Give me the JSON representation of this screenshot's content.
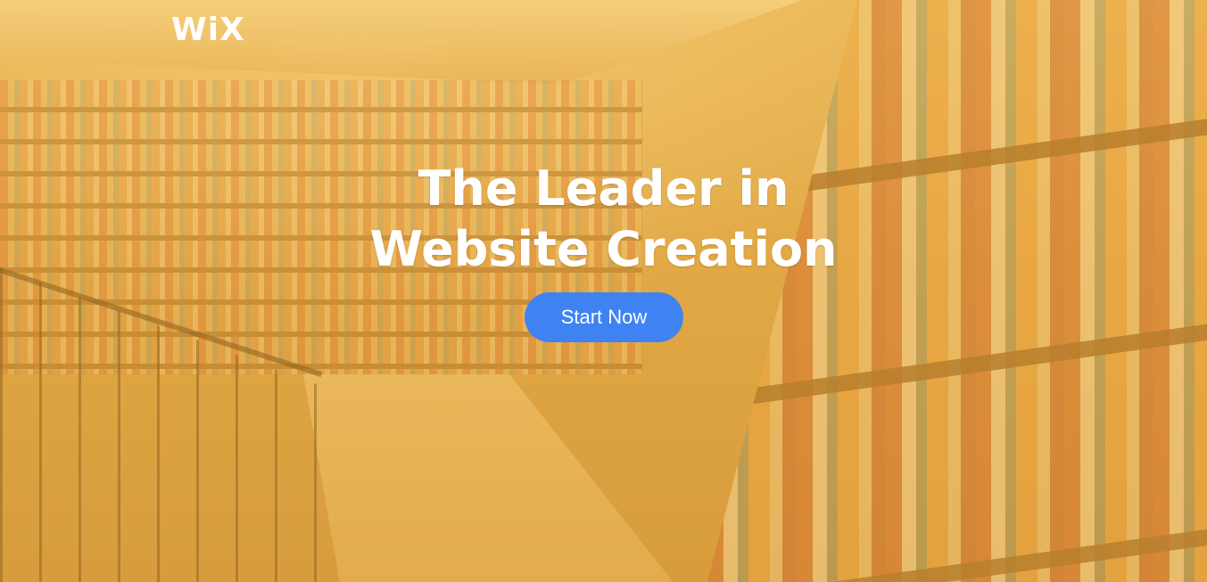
{
  "brand": {
    "logo_text": "WiX"
  },
  "hero": {
    "title_line1": "The Leader in",
    "title_line2": "Website Creation"
  },
  "cta": {
    "label": "Start Now",
    "color": "#3f83f2"
  },
  "theme": {
    "overlay_color": "#f0b43c"
  }
}
